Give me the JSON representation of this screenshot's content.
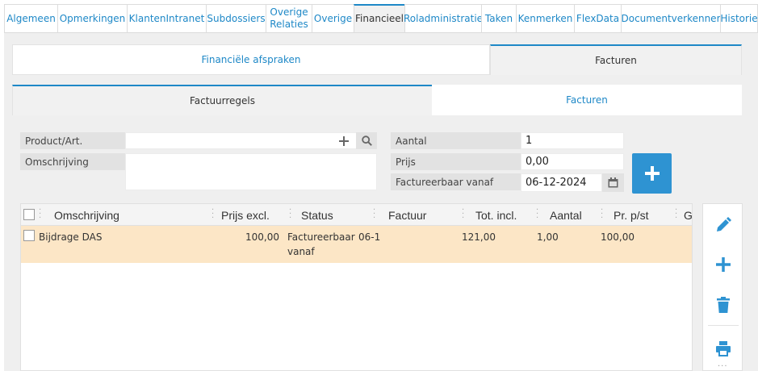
{
  "top_tabs": [
    {
      "label": "Algemeen"
    },
    {
      "label": "Opmerkingen"
    },
    {
      "label": "KlantenIntranet"
    },
    {
      "label": "Subdossiers"
    },
    {
      "label": "Overige Relaties"
    },
    {
      "label": "Overige"
    },
    {
      "label": "Financieel"
    },
    {
      "label": "Roladministratie"
    },
    {
      "label": "Taken"
    },
    {
      "label": "Kenmerken"
    },
    {
      "label": "FlexData"
    },
    {
      "label": "Documentverkenner"
    },
    {
      "label": "Historie"
    }
  ],
  "active_top_tab": "Financieel",
  "section_tabs": {
    "financiele_afspraken": "Financiële afspraken",
    "facturen": "Facturen"
  },
  "inner_tabs": {
    "factuurregels": "Factuurregels",
    "facturen": "Facturen"
  },
  "form": {
    "product_label": "Product/Art.",
    "product_value": "",
    "omschrijving_label": "Omschrijving",
    "omschrijving_value": "",
    "aantal_label": "Aantal",
    "aantal_value": "1",
    "prijs_label": "Prijs",
    "prijs_value": "0,00",
    "factureerbaar_label": "Factureerbaar vanaf",
    "factureerbaar_value": "06-12-2024"
  },
  "grid": {
    "columns": [
      "Omschrijving",
      "Prijs excl.",
      "Status",
      "Factuur",
      "Tot. incl.",
      "Aantal",
      "Pr. p/st",
      "Ge"
    ],
    "rows": [
      {
        "omschrijving": "Bijdrage DAS",
        "prijs_excl": "100,00",
        "status_line1": "Factureerbaar",
        "status_date": "06-1",
        "status_line2": "vanaf",
        "factuur": "",
        "tot_incl": "121,00",
        "aantal": "1,00",
        "pr_pst": "100,00"
      }
    ]
  },
  "colors": {
    "accent": "#1e88c7",
    "button_blue": "#2e93d2",
    "row_highlight": "#fce6c6",
    "panel_bg": "#efefef"
  },
  "icons": {
    "plus": "plus-icon",
    "search": "search-icon",
    "calendar": "calendar-icon",
    "edit": "pencil-icon",
    "delete": "trash-icon",
    "print": "printer-icon"
  }
}
